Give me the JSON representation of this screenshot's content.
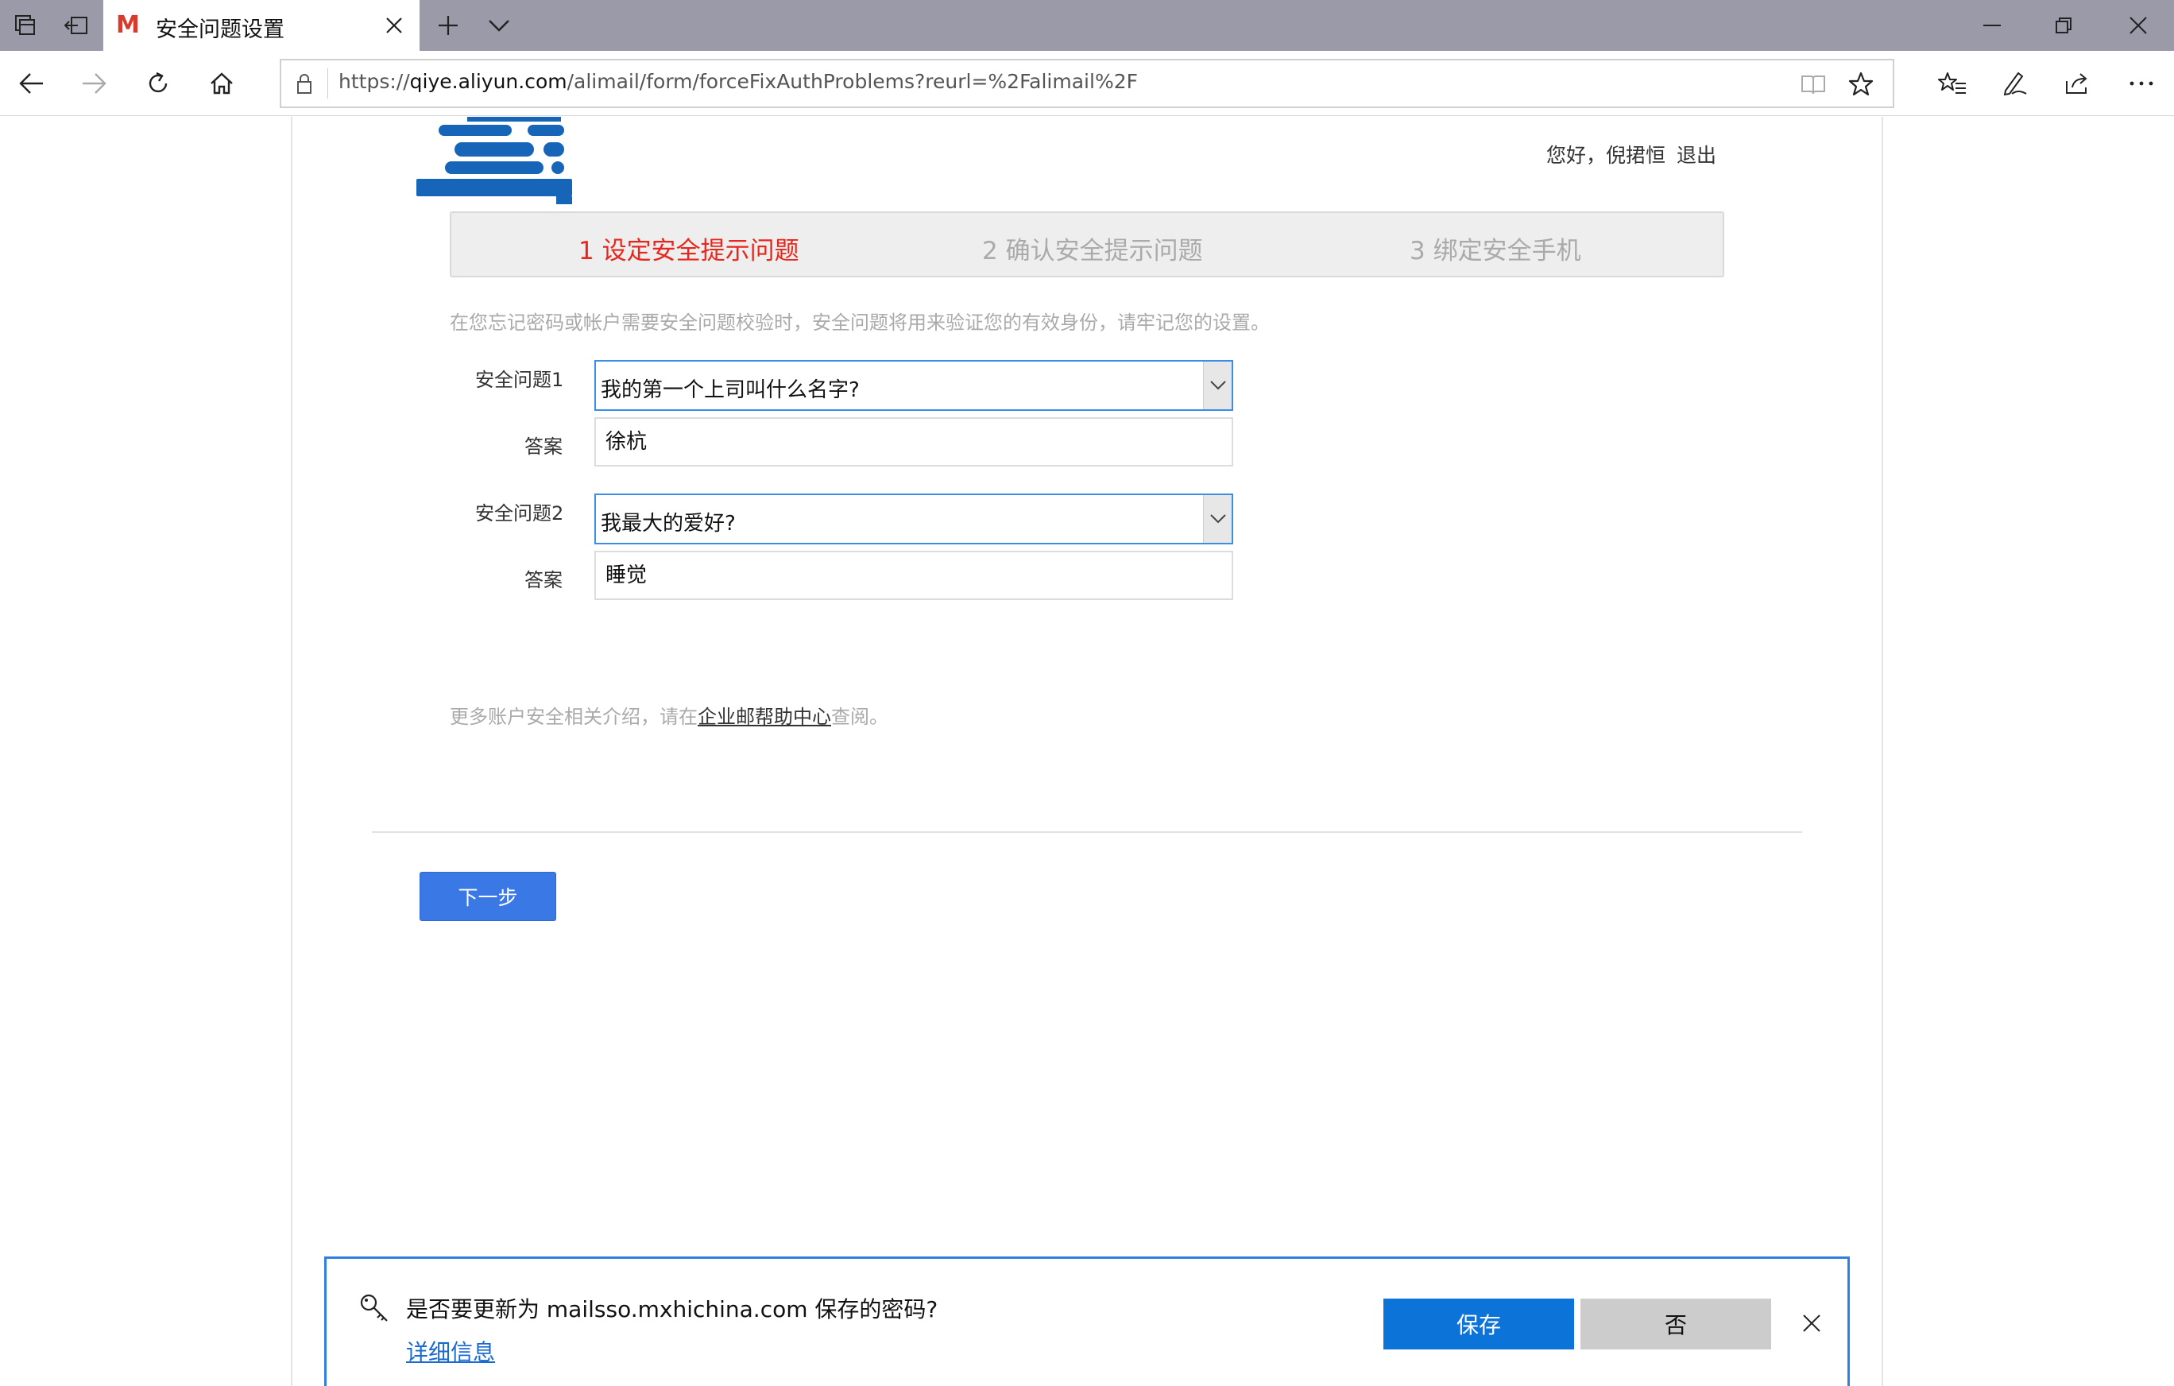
{
  "browser": {
    "tab_title": "安全问题设置",
    "tab_logo": "M",
    "url_prefix": "https://",
    "url_host": "qiye.aliyun.com",
    "url_path": "/alimail/form/forceFixAuthProblems?reurl=%2Falimail%2F",
    "icons": {
      "tab_manager": "tabs-icon",
      "set_aside": "set-aside-icon",
      "new_tab": "plus-icon",
      "tab_list": "chevron-down-icon",
      "minimize": "minimize-icon",
      "restore": "restore-icon",
      "close": "close-icon",
      "back": "back-arrow-icon",
      "forward": "forward-arrow-icon",
      "refresh": "refresh-icon",
      "home": "home-icon",
      "lock": "lock-icon",
      "reading_view": "book-icon",
      "favorite": "star-icon",
      "favorites_hub": "favorites-list-icon",
      "notes": "pen-icon",
      "share": "share-icon",
      "more": "more-icon"
    }
  },
  "header": {
    "greeting": "您好，倪捃恒",
    "logout": "退出"
  },
  "steps": [
    {
      "label": "1 设定安全提示问题",
      "active": true
    },
    {
      "label": "2 确认安全提示问题",
      "active": false
    },
    {
      "label": "3 绑定安全手机",
      "active": false
    }
  ],
  "intro": "在您忘记密码或帐户需要安全问题校验时，安全问题将用来验证您的有效身份，请牢记您的设置。",
  "form": {
    "q1_label": "安全问题1",
    "q1_value": "我的第一个上司叫什么名字?",
    "a1_label": "答案",
    "a1_value": "徐杭",
    "q2_label": "安全问题2",
    "q2_value": "我最大的爱好?",
    "a2_label": "答案",
    "a2_value": "睡觉"
  },
  "help": {
    "prefix": "更多账户安全相关介绍，请在",
    "link": "企业邮帮助中心",
    "suffix": "查阅。"
  },
  "next_button": "下一步",
  "password_prompt": {
    "message": "是否要更新为 mailsso.mxhichina.com 保存的密码?",
    "details": "详细信息",
    "save": "保存",
    "no": "否"
  },
  "colors": {
    "accent": "#3a78e6",
    "active_step": "#e8261c",
    "prompt_border": "#2f7fe0",
    "save_button": "#0c74d9"
  }
}
